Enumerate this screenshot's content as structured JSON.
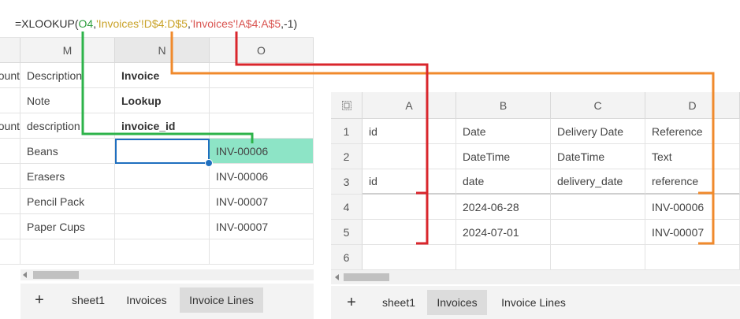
{
  "formula_bar": {
    "prefix": "=XLOOKUP(",
    "arg1": "O4",
    "arg2": "'Invoices'!D$4:D$5",
    "arg3": "'Invoices'!A$4:A$5",
    "suffix": ",-1)",
    "sep": ","
  },
  "left": {
    "columns": [
      "M",
      "N",
      "O"
    ],
    "partial_col": [
      "ount",
      "",
      "ount",
      "",
      "",
      "",
      ""
    ],
    "rows": [
      [
        "Description",
        "Invoice",
        ""
      ],
      [
        "Note",
        "Lookup",
        ""
      ],
      [
        "description",
        "invoice_id",
        ""
      ],
      [
        "Beans",
        "",
        "INV-00006"
      ],
      [
        "Erasers",
        "",
        "INV-00006"
      ],
      [
        "Pencil Pack",
        "",
        "INV-00007"
      ],
      [
        "Paper Cups",
        "",
        "INV-00007"
      ]
    ],
    "tabs": [
      "+",
      "sheet1",
      "Invoices",
      "Invoice Lines"
    ],
    "active_tab": "Invoice Lines"
  },
  "right": {
    "columns": [
      "A",
      "B",
      "C",
      "D"
    ],
    "row_numbers": [
      "1",
      "2",
      "3",
      "4",
      "5",
      "6"
    ],
    "rows": [
      [
        "id",
        "Date",
        "Delivery Date",
        "Reference"
      ],
      [
        "",
        "DateTime",
        "DateTime",
        "Text"
      ],
      [
        "id",
        "date",
        "delivery_date",
        "reference"
      ],
      [
        "",
        "2024-06-28",
        "",
        "INV-00006"
      ],
      [
        "",
        "2024-07-01",
        "",
        "INV-00007"
      ],
      [
        "",
        "",
        "",
        ""
      ]
    ],
    "tabs": [
      "+",
      "sheet1",
      "Invoices",
      "Invoice Lines"
    ],
    "active_tab": "Invoices"
  },
  "colors": {
    "arg1": "#2e9e3e",
    "arg2": "#c9a227",
    "arg3": "#d9534f",
    "line_green": "#2db34a",
    "line_orange": "#f08a2c",
    "line_red": "#d9262c",
    "highlight": "#8de4c6",
    "selection": "#1f6fbf"
  },
  "icons": {
    "select_all": "select-all-icon",
    "add_sheet": "plus-icon",
    "scroll_left": "caret-left-icon"
  }
}
